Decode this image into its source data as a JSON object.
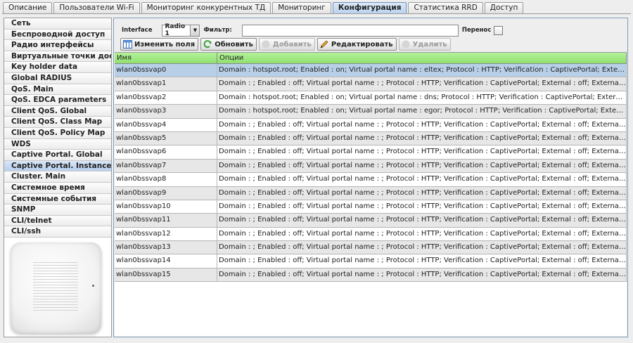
{
  "tabs": [
    {
      "label": "Описание"
    },
    {
      "label": "Пользователи Wi-Fi"
    },
    {
      "label": "Мониторинг конкурентных ТД"
    },
    {
      "label": "Мониторинг"
    },
    {
      "label": "Конфигурация",
      "active": true
    },
    {
      "label": "Статистика RRD"
    },
    {
      "label": "Доступ"
    }
  ],
  "sidebar": {
    "items": [
      {
        "label": "Сеть"
      },
      {
        "label": "Беспроводной доступ"
      },
      {
        "label": "Радио интерфейсы"
      },
      {
        "label": "Виртуальные точки доступа"
      },
      {
        "label": "Key holder data"
      },
      {
        "label": "Global RADIUS"
      },
      {
        "label": "QoS. Main"
      },
      {
        "label": "QoS. EDCA parameters"
      },
      {
        "label": "Client QoS. Global"
      },
      {
        "label": "Client QoS. Class Map"
      },
      {
        "label": "Client QoS. Policy Map"
      },
      {
        "label": "WDS"
      },
      {
        "label": "Captive Portal. Global"
      },
      {
        "label": "Captive Portal. Instance",
        "active": true
      },
      {
        "label": "Cluster. Main"
      },
      {
        "label": "Системное время"
      },
      {
        "label": "Системные события"
      },
      {
        "label": "SNMP"
      },
      {
        "label": "CLI/telnet"
      },
      {
        "label": "CLI/ssh"
      }
    ]
  },
  "filter": {
    "interface_label": "Interface",
    "interface_value": "Radio 1",
    "filter_label": "Фильтр:",
    "filter_value": "",
    "wrap_label": "Перенос",
    "wrap_checked": false
  },
  "toolbar": {
    "edit_fields": "Изменить поля",
    "refresh": "Обновить",
    "add": "Добавить",
    "edit": "Редактировать",
    "delete": "Удалить"
  },
  "table": {
    "columns": [
      "Имя",
      "Опции"
    ],
    "rows": [
      {
        "name": "wlan0bssvap0",
        "options": "Domain : hotspot.root; Enabled : on; Virtual portal name : eltex; Protocol : HTTP; Verification : CaptivePortal; External : on; External ...",
        "selected": true
      },
      {
        "name": "wlan0bssvap1",
        "options": "Domain : ; Enabled : off; Virtual portal name : ; Protocol : HTTP; Verification : CaptivePortal; External : off; External URL : ; Permitted..."
      },
      {
        "name": "wlan0bssvap2",
        "options": "Domain : hotspot.root; Enabled : on; Virtual portal name : dns; Protocol : HTTP; Verification : CaptivePortal; External : on; External ..."
      },
      {
        "name": "wlan0bssvap3",
        "options": "Domain : hotspot.root; Enabled : on; Virtual portal name : egor; Protocol : HTTP; Verification : CaptivePortal; External : on; External ..."
      },
      {
        "name": "wlan0bssvap4",
        "options": "Domain : ; Enabled : off; Virtual portal name : ; Protocol : HTTP; Verification : CaptivePortal; External : off; External URL : ; Permitted..."
      },
      {
        "name": "wlan0bssvap5",
        "options": "Domain : ; Enabled : off; Virtual portal name : ; Protocol : HTTP; Verification : CaptivePortal; External : off; External URL : ; Permitted..."
      },
      {
        "name": "wlan0bssvap6",
        "options": "Domain : ; Enabled : off; Virtual portal name : ; Protocol : HTTP; Verification : CaptivePortal; External : off; External URL : ; Permitted..."
      },
      {
        "name": "wlan0bssvap7",
        "options": "Domain : ; Enabled : off; Virtual portal name : ; Protocol : HTTP; Verification : CaptivePortal; External : off; External URL : ; Permitted..."
      },
      {
        "name": "wlan0bssvap8",
        "options": "Domain : ; Enabled : off; Virtual portal name : ; Protocol : HTTP; Verification : CaptivePortal; External : off; External URL : ; Permitted..."
      },
      {
        "name": "wlan0bssvap9",
        "options": "Domain : ; Enabled : off; Virtual portal name : ; Protocol : HTTP; Verification : CaptivePortal; External : off; External URL : ; Permitted..."
      },
      {
        "name": "wlan0bssvap10",
        "options": "Domain : ; Enabled : off; Virtual portal name : ; Protocol : HTTP; Verification : CaptivePortal; External : off; External URL : ; Permitted..."
      },
      {
        "name": "wlan0bssvap11",
        "options": "Domain : ; Enabled : off; Virtual portal name : ; Protocol : HTTP; Verification : CaptivePortal; External : off; External URL : ; Permitted..."
      },
      {
        "name": "wlan0bssvap12",
        "options": "Domain : ; Enabled : off; Virtual portal name : ; Protocol : HTTP; Verification : CaptivePortal; External : off; External URL : ; Permitted..."
      },
      {
        "name": "wlan0bssvap13",
        "options": "Domain : ; Enabled : off; Virtual portal name : ; Protocol : HTTP; Verification : CaptivePortal; External : off; External URL : ; Permitted..."
      },
      {
        "name": "wlan0bssvap14",
        "options": "Domain : ; Enabled : off; Virtual portal name : ; Protocol : HTTP; Verification : CaptivePortal; External : off; External URL : ; Permitted..."
      },
      {
        "name": "wlan0bssvap15",
        "options": "Domain : ; Enabled : off; Virtual portal name : ; Protocol : HTTP; Verification : CaptivePortal; External : off; External URL : ; Permitted..."
      }
    ]
  },
  "colors": {
    "header_green": "#9be57f",
    "selected_row": "#b8cfe8",
    "active_tab": "#c6daf2"
  }
}
